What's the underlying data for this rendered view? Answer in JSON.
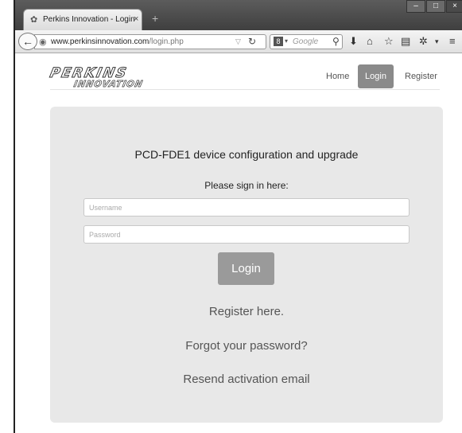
{
  "browser": {
    "tab_title": "Perkins Innovation - Login",
    "tab_close": "×",
    "new_tab": "+",
    "url_host": "www.perkinsinnovation.com",
    "url_path": "/login.php",
    "search_placeholder": "Google",
    "window_controls": {
      "minimize": "–",
      "maximize": "□",
      "close": "×"
    }
  },
  "site": {
    "logo_line1": "PERKINS",
    "logo_line2": "INNOVATION",
    "nav": {
      "home": "Home",
      "login": "Login",
      "register": "Register"
    }
  },
  "form": {
    "heading": "PCD-FDE1 device configuration and upgrade",
    "subheading": "Please sign in here:",
    "username_placeholder": "Username",
    "password_placeholder": "Password",
    "login_button": "Login",
    "register_link": "Register here.",
    "forgot_link": "Forgot your password?",
    "resend_link": "Resend activation email"
  },
  "colors": {
    "panel": "#e8e8e8",
    "active_nav": "#8a8a8a",
    "login_button": "#9a9a9a"
  }
}
